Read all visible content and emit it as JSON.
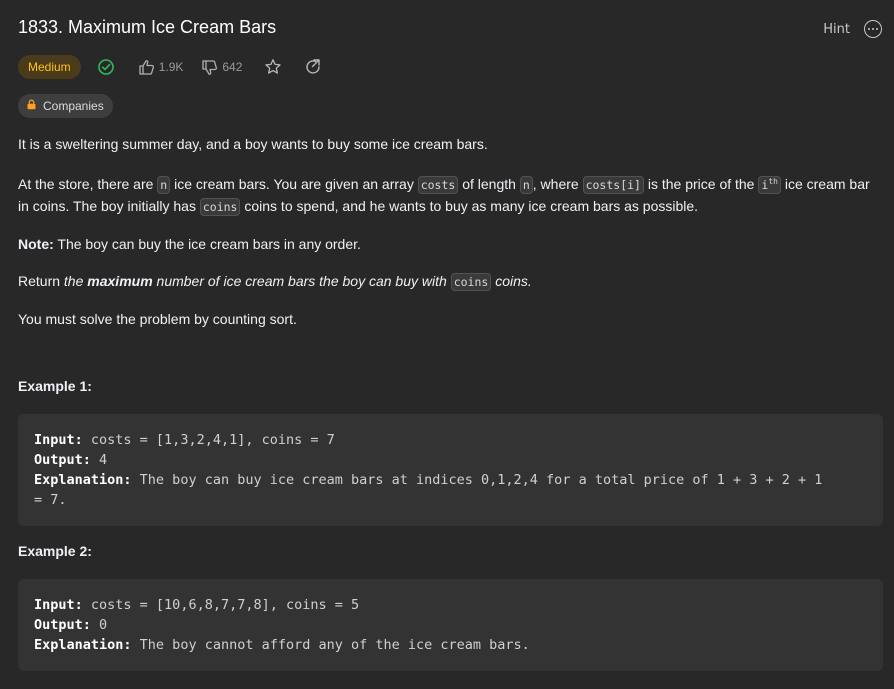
{
  "problem": {
    "title": "1833. Maximum Ice Cream Bars",
    "hint_label": "Hint",
    "difficulty": "Medium",
    "likes": "1.9K",
    "dislikes": "642",
    "companies_label": "Companies"
  },
  "description": {
    "p1": "It is a sweltering summer day, and a boy wants to buy some ice cream bars.",
    "p2_a": "At the store, there are ",
    "p2_code_n1": "n",
    "p2_b": " ice cream bars. You are given an array ",
    "p2_code_costs": "costs",
    "p2_c": " of length ",
    "p2_code_n2": "n",
    "p2_d": ", where ",
    "p2_code_costs_i": "costs[i]",
    "p2_e": " is the price of the ",
    "p2_code_i": "i",
    "p2_sup": "th",
    "p2_f": " ice cream bar in coins. The boy initially has ",
    "p2_code_coins": "coins",
    "p2_g": " coins to spend, and he wants to buy as many ice cream bars as possible.",
    "note_label": "Note:",
    "note_text": " The boy can buy the ice cream bars in any order.",
    "ret_a": "Return ",
    "ret_b": "the ",
    "ret_bold": "maximum",
    "ret_c": " number of ice cream bars the boy can buy with ",
    "ret_code": "coins",
    "ret_d": " coins.",
    "p5": "You must solve the problem by counting sort."
  },
  "examples": [
    {
      "title": "Example 1:",
      "input_label": "Input:",
      "input": " costs = [1,3,2,4,1], coins = 7",
      "output_label": "Output:",
      "output": " 4",
      "explanation_label": "Explanation:",
      "explanation": " The boy can buy ice cream bars at indices 0,1,2,4 for a total price of 1 + 3 + 2 + 1",
      "explanation_cont": "= 7."
    },
    {
      "title": "Example 2:",
      "input_label": "Input:",
      "input": " costs = [10,6,8,7,7,8], coins = 5",
      "output_label": "Output:",
      "output": " 0",
      "explanation_label": "Explanation:",
      "explanation": " The boy cannot afford any of the ice cream bars."
    }
  ],
  "colors": {
    "background": "#282828",
    "medium_badge_text": "#ffc01e",
    "medium_badge_bg": "#4a3b1b",
    "solved_check": "#2cbb5d",
    "code_block_bg": "#333333"
  },
  "icons": [
    "more-icon",
    "solved-check-icon",
    "thumbs-up-icon",
    "thumbs-down-icon",
    "star-icon",
    "share-icon",
    "lock-icon"
  ]
}
